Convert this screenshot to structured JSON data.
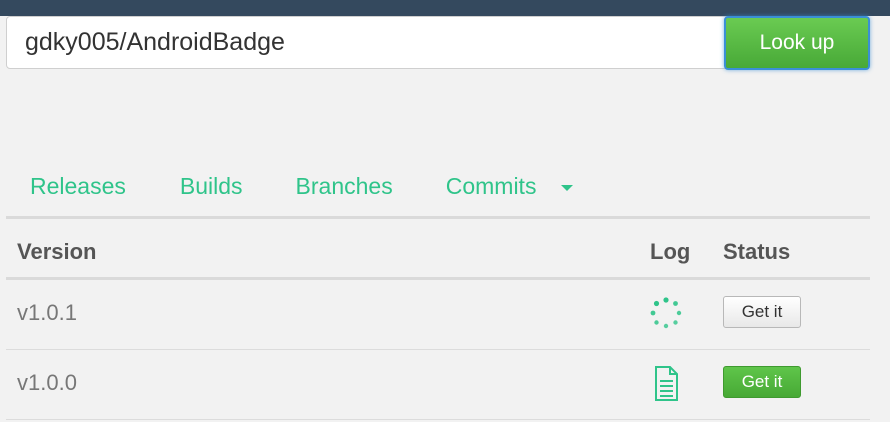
{
  "search": {
    "value": "gdky005/AndroidBadge",
    "button_label": "Look up"
  },
  "tabs": [
    {
      "label": "Releases"
    },
    {
      "label": "Builds"
    },
    {
      "label": "Branches"
    },
    {
      "label": "Commits",
      "icon": "caret-down-icon"
    }
  ],
  "table": {
    "headers": {
      "version": "Version",
      "log": "Log",
      "status": "Status"
    },
    "rows": [
      {
        "version": "v1.0.1",
        "log_icon": "loading-spinner-icon",
        "status_label": "Get it",
        "status_style": "default"
      },
      {
        "version": "v1.0.0",
        "log_icon": "document-icon",
        "status_label": "Get it",
        "status_style": "success"
      }
    ]
  },
  "colors": {
    "accent": "#2fc48a",
    "topbar": "#34495e",
    "success": "#4cae38"
  }
}
